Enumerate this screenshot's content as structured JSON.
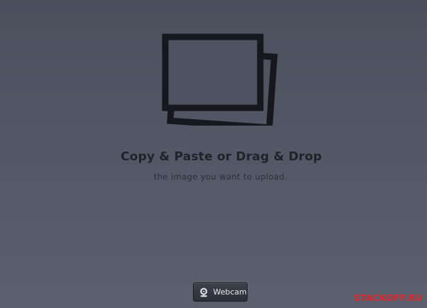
{
  "upload": {
    "headline": "Copy & Paste or Drag & Drop",
    "subline": "the image you want to upload.",
    "icon": "photos-stack-icon"
  },
  "webcam": {
    "label": "Webcam",
    "icon": "webcam-icon"
  },
  "watermark": {
    "text": "STACKOFF.RU",
    "color": "#e0242a"
  },
  "colors": {
    "background": "#535866",
    "icon": "#16181d",
    "headline": "#1f2229"
  }
}
